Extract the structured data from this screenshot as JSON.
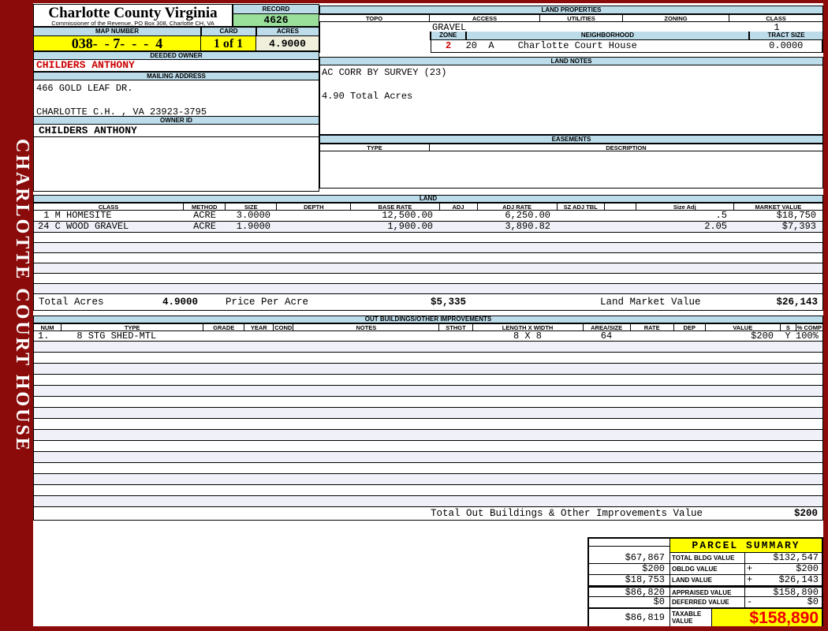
{
  "colors": {
    "frame_maroon": "#8B0B0B",
    "header_blue": "#BCDCEA",
    "record_green": "#9ADF9A",
    "highlight_yellow": "#FFFF00",
    "acres_cream": "#EFEFDC",
    "row_stripe": "#F0F0F8",
    "owner_red": "#CC0000",
    "taxable_red": "#EE0000"
  },
  "sidebar": {
    "text": "CHARLOTTE COURT HOUSE"
  },
  "header": {
    "county_title": "Charlotte County Virginia",
    "county_subtitle": "Commissioner of the Revenue, PO Box 308, Charlotte CH, VA",
    "record_label": "RECORD",
    "record_value": "4626",
    "map_number_label": "MAP NUMBER",
    "map_number_value": "038-  - 7-  -  -  4",
    "card_label": "CARD",
    "card_value": "1 of 1",
    "acres_label": "ACRES",
    "acres_value": "4.9000",
    "deeded_owner_label": "DEEDED OWNER",
    "deeded_owner_value": "CHILDERS ANTHONY",
    "mailing_address_label": "MAILING ADDRESS",
    "address_line1": "466 GOLD LEAF DR.",
    "address_line2": "CHARLOTTE C.H. , VA 23923-3795",
    "owner_id_label": "OWNER ID",
    "owner_id_value": "CHILDERS ANTHONY"
  },
  "land_properties": {
    "title": "LAND PROPERTIES",
    "headers": [
      "TOPO",
      "ACCESS",
      "UTILITIES",
      "ZONING",
      "CLASS"
    ],
    "access_value": "GRAVEL",
    "class_value": "1",
    "zone_label": "ZONE",
    "zone_value": "2",
    "neighborhood_label": "NEIGHBORHOOD",
    "neighborhood_code": "20  A",
    "neighborhood_name": "Charlotte Court House",
    "tract_size_label": "TRACT SIZE",
    "tract_size_value": "0.0000"
  },
  "land_notes": {
    "title": "LAND NOTES",
    "line1": "AC CORR BY SURVEY (23)",
    "line2": "4.90 Total Acres"
  },
  "easements": {
    "title": "EASEMENTS",
    "type_label": "TYPE",
    "description_label": "DESCRIPTION"
  },
  "land_table": {
    "title": "LAND",
    "columns": [
      "CLASS",
      "METHOD",
      "SIZE",
      "DEPTH",
      "BASE RATE",
      "ADJ",
      "ADJ RATE",
      "SZ ADJ TBL",
      "",
      "Size Adj",
      "MARKET VALUE"
    ],
    "rows": [
      [
        " 1 M HOMESITE",
        "ACRE",
        "3.0000",
        "",
        "12,500.00",
        "",
        "6,250.00",
        "",
        "",
        ".5",
        "$18,750"
      ],
      [
        "24 C WOOD GRAVEL",
        "ACRE",
        "1.9000",
        "",
        "1,900.00",
        "",
        "3,890.82",
        "",
        "",
        "2.05",
        "$7,393"
      ]
    ],
    "empty_row_count": 6,
    "total_acres_label": "Total Acres",
    "total_acres_value": "4.9000",
    "price_per_acre_label": "Price Per Acre",
    "price_per_acre_value": "$5,335",
    "land_market_value_label": "Land Market Value",
    "land_market_value": "$26,143"
  },
  "out_buildings": {
    "title": "OUT BUILDINGS/OTHER IMPROVEMENTS",
    "columns": [
      "NUM",
      "TYPE",
      "GRADE",
      "YEAR",
      "COND",
      "NOTES",
      "STHGT",
      "LENGTH X WIDTH",
      "AREA/SIZE",
      "RATE",
      "DEP",
      "VALUE",
      "S",
      "% COMP"
    ],
    "rows": [
      [
        "1.",
        "  8 STG SHED-MTL",
        "",
        "",
        "",
        "",
        "",
        "8 X 8",
        "64",
        "",
        "",
        "$200",
        "Y",
        "100%"
      ]
    ],
    "empty_row_count": 15,
    "total_label": "Total Out Buildings & Other Improvements Value",
    "total_value": "$200"
  },
  "parcel_summary": {
    "title": "PARCEL SUMMARY",
    "rows": [
      {
        "left": "$67,867",
        "label": "TOTAL BLDG VALUE",
        "sign": "",
        "value": "$132,547"
      },
      {
        "left": "$200",
        "label": "OBLDG VALUE",
        "sign": "+",
        "value": "$200"
      },
      {
        "left": "$18,753",
        "label": "LAND VALUE",
        "sign": "+",
        "value": "$26,143"
      },
      {
        "left": "$86,820",
        "label": "APPRAISED VALUE",
        "sign": "",
        "value": "$158,890"
      },
      {
        "left": "$0",
        "label": "DEFERRED VALUE",
        "sign": "-",
        "value": "$0"
      }
    ],
    "taxable_left": "$86,819",
    "taxable_label": "TAXABLE VALUE",
    "taxable_value": "$158,890"
  }
}
